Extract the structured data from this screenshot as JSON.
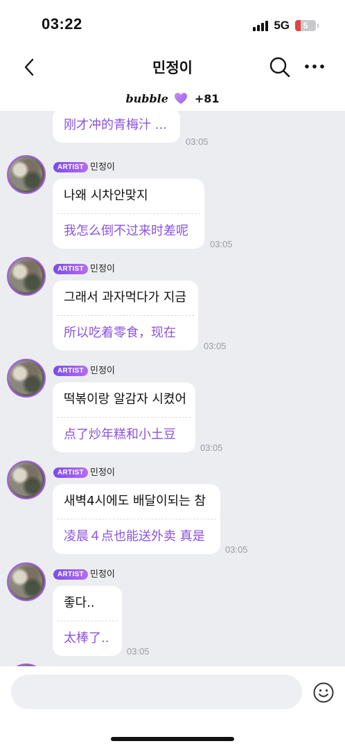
{
  "status_bar": {
    "time": "03:22",
    "network": "5G",
    "battery": "5"
  },
  "nav": {
    "title": "민정이",
    "icons": [
      "chevron-left-icon",
      "search-icon",
      "more-icon"
    ]
  },
  "sub_bar": {
    "logo": "bubble",
    "count": "+81",
    "icon": "heart-icon"
  },
  "colors": {
    "accent": "#8a52df",
    "badge_start": "#7a4de8",
    "badge_end": "#b46cf0",
    "chat_background": "#ecedf1"
  },
  "messages": [
    {
      "partial": true,
      "translation": "刚才冲的青梅汁 ...",
      "time": "03:05"
    },
    {
      "badge": "ARTIST",
      "sender": "민정이",
      "text": "나왜 시차안맞지",
      "translation": "我怎么倒不过来时差呢",
      "time": "03:05"
    },
    {
      "badge": "ARTIST",
      "sender": "민정이",
      "text": "그래서 과자먹다가 지금",
      "translation": "所以吃着零食，现在",
      "time": "03:05"
    },
    {
      "badge": "ARTIST",
      "sender": "민정이",
      "text": "떡볶이랑 알감자 시켰어",
      "translation": "点了炒年糕和小土豆",
      "time": "03:05"
    },
    {
      "badge": "ARTIST",
      "sender": "민정이",
      "text": "새벽4시에도 배달이되는 참",
      "translation": "凌晨４点也能送外卖 真是",
      "time": "03:05"
    },
    {
      "badge": "ARTIST",
      "sender": "민정이",
      "text": "좋다..",
      "translation": "太棒了..",
      "time": "03:05"
    }
  ],
  "input": {
    "placeholder": "",
    "emoji_icon": "smiley-icon"
  }
}
